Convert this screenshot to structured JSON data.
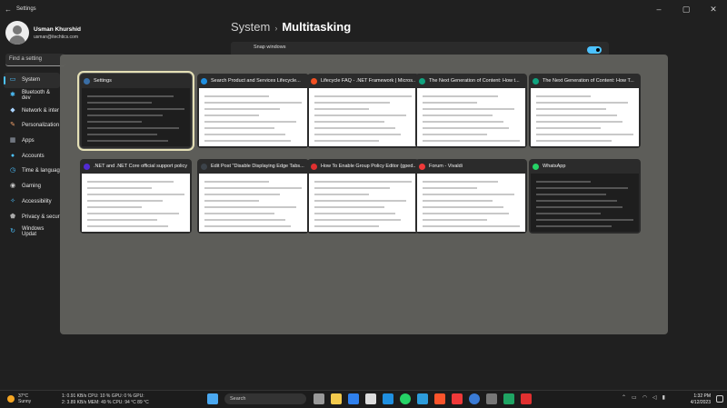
{
  "window": {
    "title": "Settings"
  },
  "profile": {
    "name": "Usman Khurshid",
    "email": "usman@itechtics.com"
  },
  "search": {
    "placeholder": "Find a setting"
  },
  "sidebar": {
    "items": [
      {
        "label": "System",
        "icon": "system-icon",
        "active": true
      },
      {
        "label": "Bluetooth & dev",
        "icon": "bluetooth-icon"
      },
      {
        "label": "Network & inter",
        "icon": "network-icon"
      },
      {
        "label": "Personalization",
        "icon": "paintbrush-icon"
      },
      {
        "label": "Apps",
        "icon": "apps-icon"
      },
      {
        "label": "Accounts",
        "icon": "accounts-icon"
      },
      {
        "label": "Time & languag",
        "icon": "clock-icon"
      },
      {
        "label": "Gaming",
        "icon": "gaming-icon"
      },
      {
        "label": "Accessibility",
        "icon": "accessibility-icon"
      },
      {
        "label": "Privacy & secur",
        "icon": "shield-icon"
      },
      {
        "label": "Windows Updat",
        "icon": "update-icon"
      }
    ]
  },
  "header": {
    "parent": "System",
    "current": "Multitasking",
    "separator": "›"
  },
  "setting": {
    "snap_label": "Snap windows"
  },
  "taskview": {
    "row1": [
      {
        "title": "Settings",
        "icon_color": "#3a6ea5",
        "thumb": "dark"
      },
      {
        "title": "Search Product and Services Lifecycle...",
        "icon_color": "#1f8fe0",
        "thumb": "light"
      },
      {
        "title": "Lifecycle FAQ - .NET Framework | Micros...",
        "icon_color": "#f25022",
        "thumb": "light"
      },
      {
        "title": "The Next Generation of Content: How t...",
        "icon_color": "#10a37f",
        "thumb": "light"
      },
      {
        "title": "The Next Generation of Content: How T...",
        "icon_color": "#10a37f",
        "thumb": "light"
      }
    ],
    "row2": [
      {
        "title": ".NET and .NET Core official support policy",
        "icon_color": "#512bd4",
        "thumb": "light"
      },
      {
        "title": "Edit Post \"Disable Displaying Edge Tabs...",
        "icon_color": "#3c434a",
        "thumb": "light"
      },
      {
        "title": "How To Enable Group Policy Editor (gped...",
        "icon_color": "#e03030",
        "thumb": "light"
      },
      {
        "title": "Forum - Vivaldi",
        "icon_color": "#ef3939",
        "thumb": "light"
      },
      {
        "title": "WhatsApp",
        "icon_color": "#25d366",
        "thumb": "dark"
      }
    ]
  },
  "taskbar": {
    "weather_temp": "37°C",
    "weather_desc": "Sunny",
    "perf_line1": "1:   0.91 KB/s CPU:  10 % GPU:      0 % GPU:",
    "perf_line2": "2:   3.89 KB/s MEM: 49 % CPU:  94 °C  89 °C",
    "search_label": "Search",
    "time": "1:32 PM",
    "date": "4/12/2023"
  },
  "colors": {
    "accent": "#4cc2ff",
    "selected_outline": "#e5e0b6",
    "overlay": "#60605c"
  }
}
